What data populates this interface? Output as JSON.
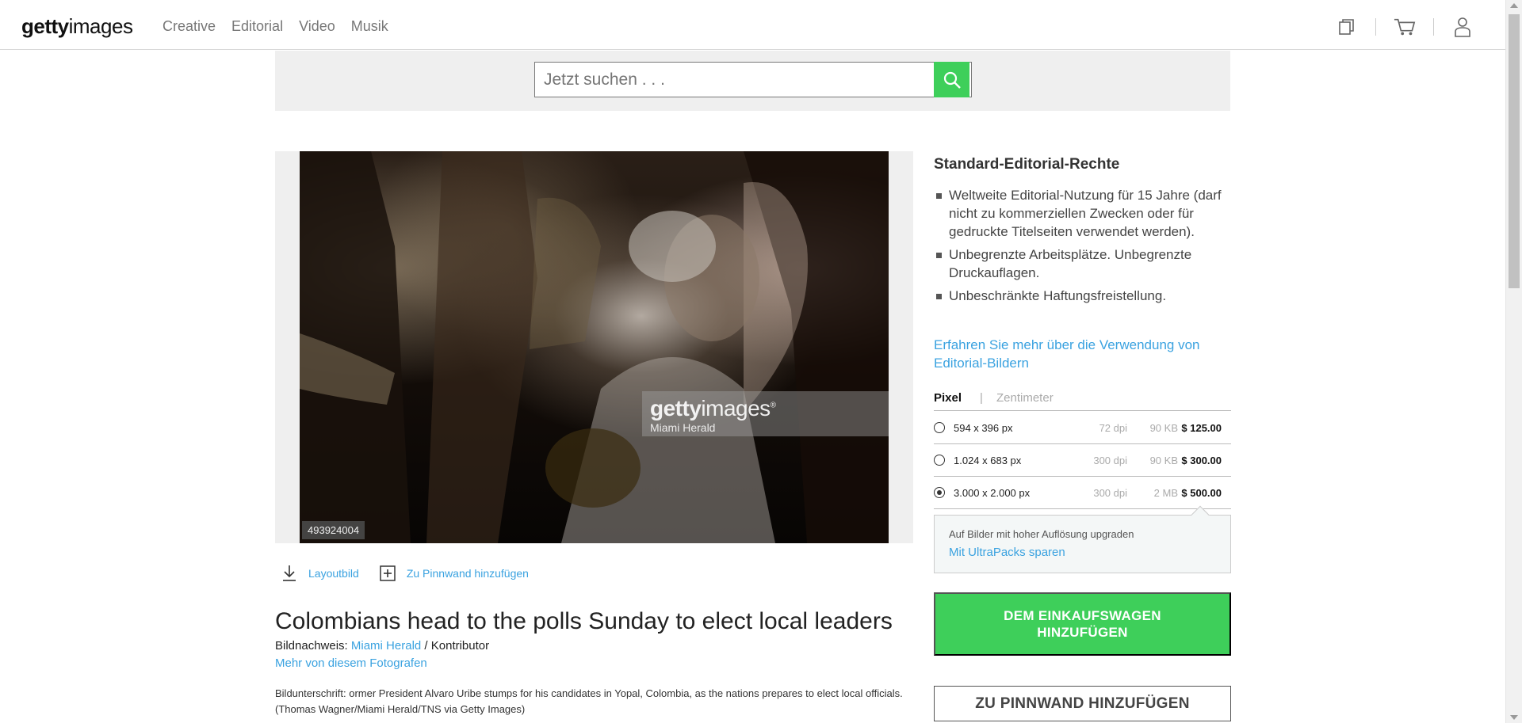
{
  "header": {
    "logo_bold": "getty",
    "logo_light": "images",
    "nav": [
      "Creative",
      "Editorial",
      "Video",
      "Musik"
    ],
    "icons": [
      "boards-icon",
      "cart-icon",
      "user-icon"
    ]
  },
  "search": {
    "placeholder": "Jetzt suchen . . ."
  },
  "image": {
    "id": "493924004",
    "watermark_bold": "getty",
    "watermark_light": "images",
    "watermark_credit": "Miami Herald"
  },
  "actions": {
    "layout": "Layoutbild",
    "board": "Zu Pinnwand hinzufügen"
  },
  "details": {
    "title": "Colombians head to the polls Sunday to elect local leaders",
    "credit_label": "Bildnachweis:",
    "credit_name": "Miami Herald",
    "credit_suffix": " / Kontributor",
    "more": "Mehr von diesem Fotografen",
    "caption_label": "Bildunterschrift:",
    "caption_text": "ormer President Alvaro Uribe stumps for his candidates in Yopal, Colombia, as the nations prepares to elect local officials. (Thomas Wagner/Miami Herald/TNS via Getty Images)"
  },
  "rights": {
    "title": "Standard-Editorial-Rechte",
    "items": [
      "Weltweite Editorial-Nutzung für 15 Jahre (darf nicht zu kommerziellen Zwecken oder für gedruckte Titelseiten verwendet werden).",
      "Unbegrenzte Arbeitsplätze. Unbegrenzte Druckauflagen.",
      "Unbeschränkte Haftungsfreistellung."
    ],
    "link": "Erfahren Sie mehr über die Verwendung von Editorial-Bildern"
  },
  "units": {
    "active": "Pixel",
    "separator": "|",
    "inactive": "Zentimeter"
  },
  "sizes": [
    {
      "dim": "594 x 396 px",
      "dpi": "72 dpi",
      "size": "90 KB",
      "price": "$ 125.00",
      "selected": false
    },
    {
      "dim": "1.024 x 683 px",
      "dpi": "300 dpi",
      "size": "90 KB",
      "price": "$ 300.00",
      "selected": false
    },
    {
      "dim": "3.000 x 2.000 px",
      "dpi": "300 dpi",
      "size": "2 MB",
      "price": "$ 500.00",
      "selected": true
    }
  ],
  "upgrade": {
    "line1": "Auf Bilder mit hoher Auflösung upgraden",
    "line2": "Mit  UltraPacks sparen"
  },
  "buttons": {
    "cart": "DEM EINKAUFSWAGEN HINZUFÜGEN",
    "board": "ZU PINNWAND HINZUFÜGEN"
  },
  "colors": {
    "accent_green": "#3ecf5a",
    "link_blue": "#3aa2e0"
  }
}
